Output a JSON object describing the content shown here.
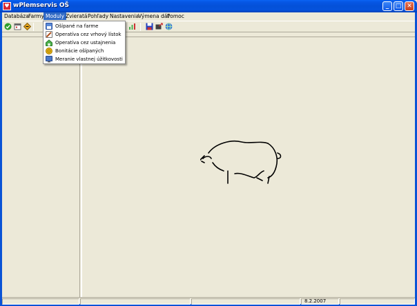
{
  "window": {
    "title": "wPlemservis OŠ",
    "app_icon_glyph": "♥",
    "minimize": "_",
    "maximize": "□",
    "close": "✕"
  },
  "menubar": {
    "items": [
      {
        "label": "Databáza"
      },
      {
        "label": "Farmy"
      },
      {
        "label": "Moduly"
      },
      {
        "label": "Zvieratá"
      },
      {
        "label": "Pohľady"
      },
      {
        "label": "Nastavenia"
      },
      {
        "label": "Výmena dát"
      },
      {
        "label": "Pomoc"
      }
    ],
    "active_index": 2
  },
  "toolbar": {
    "tools": [
      {
        "icon": "check-icon",
        "color": "#2e9e2e"
      },
      {
        "icon": "calendar-icon",
        "color": "#6b6b6b"
      },
      {
        "icon": "diamond-sign-icon",
        "color": "#e0a420"
      },
      {
        "icon": "chart-icon",
        "color": "#4caf50"
      },
      {
        "icon": "save-icon",
        "color": "#1f3fbf"
      },
      {
        "icon": "export-icon",
        "color": "#404040"
      },
      {
        "icon": "network-icon",
        "color": "#3b7dd8"
      }
    ]
  },
  "dropdown": {
    "items": [
      {
        "label": "Ošípané na farme",
        "icon": "farm-icon",
        "color": "#5a8ad8"
      },
      {
        "label": "Operatíva cez vrhový lístok",
        "icon": "pencil-icon",
        "color": "#b0501c"
      },
      {
        "label": "Operatíva cez ustajnenia",
        "icon": "barn-icon",
        "color": "#4db24d"
      },
      {
        "label": "Bonitácie ošípaných",
        "icon": "coins-icon",
        "color": "#e7b416"
      },
      {
        "label": "Meranie vlastnej úžitkovosti",
        "icon": "monitor-icon",
        "color": "#4a78c8"
      }
    ]
  },
  "statusbar": {
    "cells": [
      "",
      "",
      "",
      "8.2.2007",
      ""
    ]
  }
}
